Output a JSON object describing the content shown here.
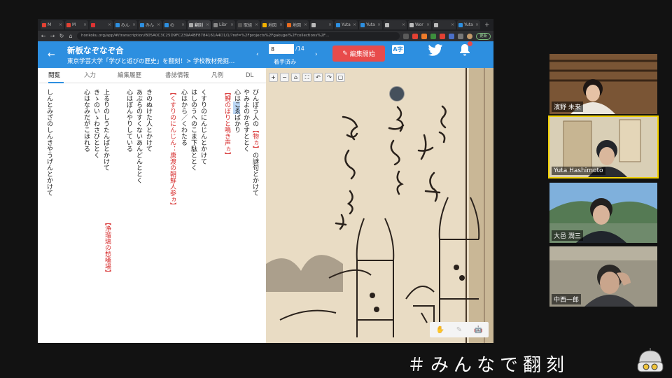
{
  "browser": {
    "tabs": [
      {
        "label": "M",
        "color": "#e34133"
      },
      {
        "label": "M",
        "color": "#e34133"
      },
      {
        "label": "",
        "color": "#d33"
      },
      {
        "label": "みん",
        "color": "#2d8fe0"
      },
      {
        "label": "みん",
        "color": "#2d8fe0"
      },
      {
        "label": "の",
        "color": "#2d8fe0"
      },
      {
        "label": "翻刻",
        "color": "#aaa",
        "active": true
      },
      {
        "label": "Libr",
        "color": "#888"
      },
      {
        "label": "取組",
        "color": "#555"
      },
      {
        "label": "地図",
        "color": "#f2b100"
      },
      {
        "label": "地図",
        "color": "#e86b1f"
      },
      {
        "label": "",
        "color": "#bbb"
      },
      {
        "label": "Yuta",
        "color": "#2d8fe0"
      },
      {
        "label": "Yuta",
        "color": "#2d8fe0"
      },
      {
        "label": "",
        "color": "#bbb"
      },
      {
        "label": "Wor",
        "color": "#bbb"
      },
      {
        "label": "",
        "color": "#bbb"
      },
      {
        "label": "Yuta",
        "color": "#2d8fe0"
      }
    ],
    "new_tab": "+",
    "url": "honkoku.org/app/#/transcription/B05A0C3C25D9FC239A4BF8784161A4D1/1/?ref=%2Fprojects%2Fgakugei%2Fcollections%2F…",
    "update_label": "更新"
  },
  "header": {
    "back_icon": "←",
    "title": "新板なぞなぞ合",
    "subtitle": "東京学芸大学「学びと遊びの歴史」を翻刻！> 学校教材発掘…",
    "page_value": "8",
    "page_total": "/14",
    "prev": "‹",
    "next": "›",
    "status": "着手済み",
    "edit_label": "編集開始",
    "translate_label": "A字"
  },
  "panel_tabs": {
    "view": "閲覧",
    "input": "入力",
    "history": "編集履歴",
    "meta": "書誌情報",
    "legend": "凡例",
    "dl": "DL"
  },
  "transcription": {
    "col1": {
      "a": "びんぼう人の",
      "b": "【物ヵ】",
      "c": "の謎句とかけて"
    },
    "col2": "やみよのからすととく",
    "col3": {
      "a": "心は",
      "b": "こゑ",
      "c": "ばかり"
    },
    "col4": "【鯉のぼりと鳴き声ヵ】",
    "col5": "くすりのにんじんとかけて",
    "col6": "はしのうへのこま下駄ととく",
    "col7": "心はから／くわたる",
    "col8": "【くすりのにんじん：唐渡の朝鮮人参ヵ】",
    "col9": "きのぬけた人とかけて",
    "col10": "あぶらのすくないあんどんととく",
    "col11": "心はぼんやりしている",
    "col12": "上るりのしうたんばとかけて",
    "col13": "きゝのいゝわさびととく",
    "col14": "心はなみだがこほれる",
    "col15": "【浄瑠璃の愁嘆場】",
    "col16": "しんとみざのしんきやうげんとかけて"
  },
  "viewer": {
    "zoom_tools": [
      "+",
      "−",
      "⌂",
      "⛶",
      "↶",
      "↷",
      "▢"
    ],
    "tools": [
      "✋",
      "✎",
      "🤖"
    ]
  },
  "participants": [
    {
      "name": "濱野 未来"
    },
    {
      "name": "Yuta Hashimoto"
    },
    {
      "name": "大邑 潤三"
    },
    {
      "name": "中西一郎"
    }
  ],
  "hashtag": "＃みんなで翻刻",
  "colors": {
    "header_blue": "#2d8fe0",
    "edit_red": "#e84b4b",
    "speaker_yellow": "#f2d100"
  }
}
